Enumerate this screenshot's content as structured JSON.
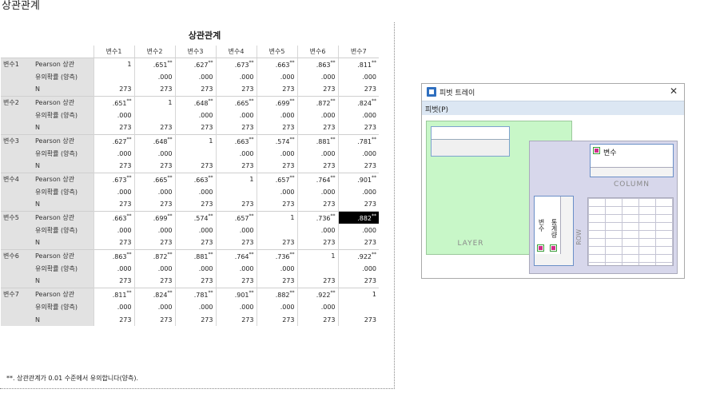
{
  "section_title": "상관관계",
  "table": {
    "title": "상관관계",
    "columns": [
      "변수1",
      "변수2",
      "변수3",
      "변수4",
      "변수5",
      "변수6",
      "변수7"
    ],
    "stat_labels": [
      "Pearson 상관",
      "유의확률 (양측)",
      "N"
    ],
    "rows": [
      {
        "label": "변수1",
        "pearson": [
          "1",
          ".651",
          ".627",
          ".673",
          ".663",
          ".863",
          ".811"
        ],
        "sig": [
          "",
          ".000",
          ".000",
          ".000",
          ".000",
          ".000",
          ".000"
        ],
        "n": [
          "273",
          "273",
          "273",
          "273",
          "273",
          "273",
          "273"
        ]
      },
      {
        "label": "변수2",
        "pearson": [
          ".651",
          "1",
          ".648",
          ".665",
          ".699",
          ".872",
          ".824"
        ],
        "sig": [
          ".000",
          "",
          ".000",
          ".000",
          ".000",
          ".000",
          ".000"
        ],
        "n": [
          "273",
          "273",
          "273",
          "273",
          "273",
          "273",
          "273"
        ]
      },
      {
        "label": "변수3",
        "pearson": [
          ".627",
          ".648",
          "1",
          ".663",
          ".574",
          ".881",
          ".781"
        ],
        "sig": [
          ".000",
          ".000",
          "",
          ".000",
          ".000",
          ".000",
          ".000"
        ],
        "n": [
          "273",
          "273",
          "273",
          "273",
          "273",
          "273",
          "273"
        ]
      },
      {
        "label": "변수4",
        "pearson": [
          ".673",
          ".665",
          ".663",
          "1",
          ".657",
          ".764",
          ".901"
        ],
        "sig": [
          ".000",
          ".000",
          ".000",
          "",
          ".000",
          ".000",
          ".000"
        ],
        "n": [
          "273",
          "273",
          "273",
          "273",
          "273",
          "273",
          "273"
        ]
      },
      {
        "label": "변수5",
        "pearson": [
          ".663",
          ".699",
          ".574",
          ".657",
          "1",
          ".736",
          ".882"
        ],
        "sig": [
          ".000",
          ".000",
          ".000",
          ".000",
          "",
          ".000",
          ".000"
        ],
        "n": [
          "273",
          "273",
          "273",
          "273",
          "273",
          "273",
          "273"
        ]
      },
      {
        "label": "변수6",
        "pearson": [
          ".863",
          ".872",
          ".881",
          ".764",
          ".736",
          "1",
          ".922"
        ],
        "sig": [
          ".000",
          ".000",
          ".000",
          ".000",
          ".000",
          "",
          ".000"
        ],
        "n": [
          "273",
          "273",
          "273",
          "273",
          "273",
          "273",
          "273"
        ]
      },
      {
        "label": "변수7",
        "pearson": [
          ".811",
          ".824",
          ".781",
          ".901",
          ".882",
          ".922",
          "1"
        ],
        "sig": [
          ".000",
          ".000",
          ".000",
          ".000",
          ".000",
          ".000",
          ""
        ],
        "n": [
          "273",
          "273",
          "273",
          "273",
          "273",
          "273",
          "273"
        ]
      }
    ],
    "significance_mark": "**",
    "selected_cell": {
      "row": 4,
      "col": 6
    },
    "footnote": "**. 상관관계가 0.01 수준에서 유의합니다(양측)."
  },
  "pivot_tray": {
    "title": "피벗 트레이",
    "close_glyph": "✕",
    "menu_label": "피벗(P)",
    "layer_label": "LAYER",
    "column_label": "COLUMN",
    "row_label": "ROW",
    "column_field": "변수",
    "row_fields": [
      "변수",
      "통계량"
    ]
  },
  "colors": {
    "selected_bg": "#000000",
    "row_header_bg": "#e2e2e2",
    "layer_bg": "#c8f7c8",
    "tray_bg": "#d7d7eb",
    "menubar_bg": "#dce7f3"
  }
}
